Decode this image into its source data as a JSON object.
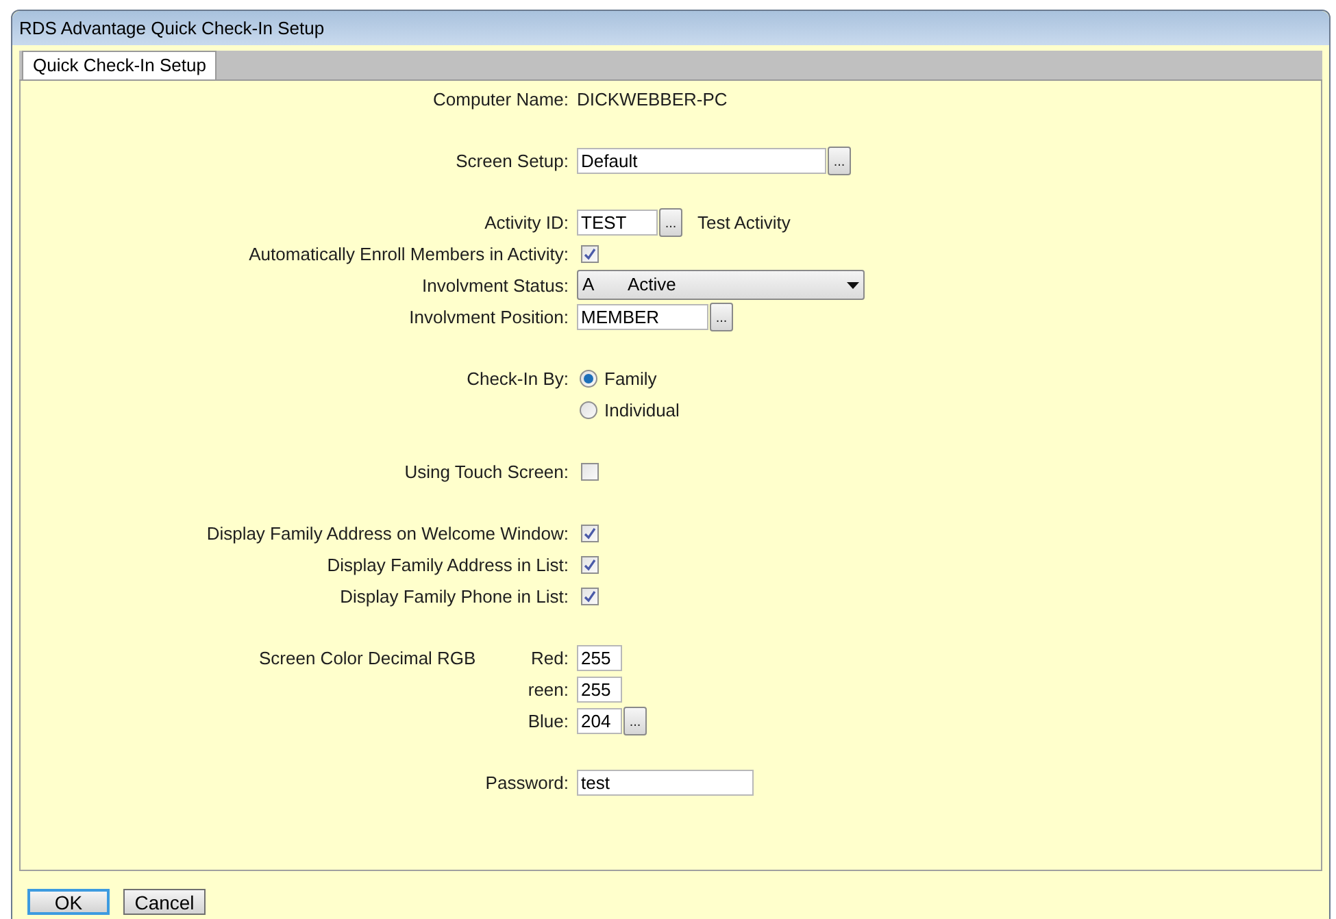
{
  "window": {
    "title": "RDS Advantage Quick Check-In Setup"
  },
  "tabs": [
    {
      "label": "Quick Check-In Setup",
      "selected": true
    }
  ],
  "sections": [
    [
      {
        "kind": "info",
        "label": "Computer Name:",
        "value": "DICKWEBBER-PC"
      }
    ],
    [
      {
        "kind": "field",
        "label": "Screen Setup:",
        "value": "Default",
        "browse_button": "..."
      }
    ],
    [
      {
        "kind": "field",
        "label": "Activity ID:",
        "value": "TEST",
        "browse_button": "...",
        "note": "Test Activity"
      },
      {
        "kind": "checkbox",
        "label": "Automatically Enroll Members in Activity:",
        "checked": true
      },
      {
        "kind": "select",
        "label": "Involvment Status:",
        "code": "A",
        "value": "Active"
      },
      {
        "kind": "field",
        "label": "Involvment Position:",
        "value": "MEMBER",
        "browse_button": "..."
      }
    ],
    [
      {
        "kind": "radio",
        "label": "Check-In By:",
        "options": [
          {
            "label": "Family",
            "selected": true
          },
          {
            "label": "Individual",
            "selected": false
          }
        ]
      }
    ],
    [
      {
        "kind": "checkbox",
        "label": "Using Touch Screen:",
        "checked": false
      }
    ],
    [
      {
        "kind": "checkbox",
        "label": "Display Family Address on Welcome Window:",
        "checked": true
      },
      {
        "kind": "checkbox",
        "label": "Display Family Address in List:",
        "checked": true
      },
      {
        "kind": "checkbox",
        "label": "Display Family Phone in List:",
        "checked": true
      }
    ],
    [
      {
        "kind": "field",
        "group_label": "Screen Color Decimal RGB",
        "label": "Red:",
        "value": "255"
      },
      {
        "kind": "field",
        "label": "reen:",
        "value": "255"
      },
      {
        "kind": "field",
        "label": "Blue:",
        "value": "204",
        "browse_button": "..."
      }
    ],
    [
      {
        "kind": "field",
        "label": "Password:",
        "value": "test"
      }
    ]
  ],
  "buttons": [
    {
      "label": "OK",
      "default": true
    },
    {
      "label": "Cancel",
      "default": false
    }
  ]
}
